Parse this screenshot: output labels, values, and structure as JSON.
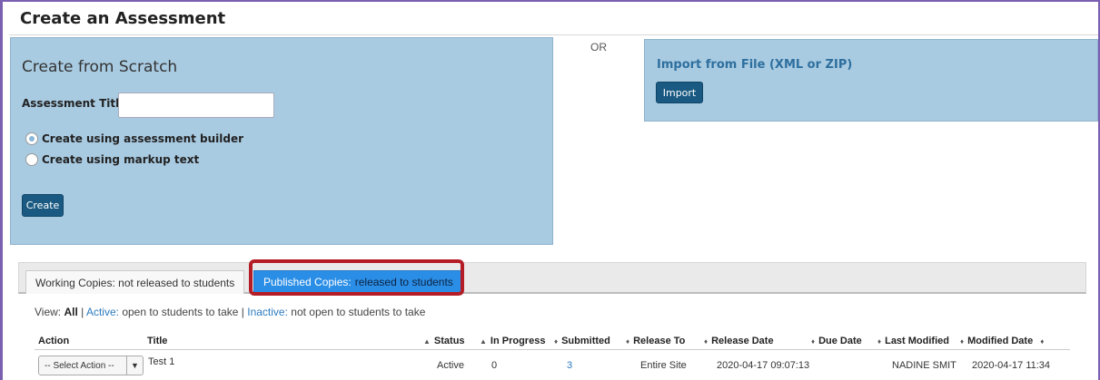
{
  "page": {
    "title": "Create an Assessment"
  },
  "scratch": {
    "heading": "Create from Scratch",
    "title_label": "Assessment Title",
    "title_value": "",
    "options": [
      {
        "label": "Create using assessment builder",
        "checked": true
      },
      {
        "label": "Create using markup text",
        "checked": false
      }
    ],
    "create_button": "Create"
  },
  "separator": "OR",
  "import": {
    "heading": "Import from File (XML or ZIP)",
    "import_button": "Import"
  },
  "tabs": {
    "working": {
      "label": "Working Copies:",
      "suffix": "not released to students"
    },
    "published": {
      "label": "Published Copies:",
      "suffix": "released to students"
    }
  },
  "view": {
    "prefix": "View:",
    "all": "All",
    "sep": "|",
    "active_link": "Active:",
    "active_desc": "open to students to take",
    "inactive_link": "Inactive:",
    "inactive_desc": "not open to students to take"
  },
  "table": {
    "headers": {
      "action": "Action",
      "title": "Title",
      "status": "Status",
      "in_progress": "In Progress",
      "submitted": "Submitted",
      "release_to": "Release To",
      "release_date": "Release Date",
      "due_date": "Due Date",
      "last_modified": "Last Modified",
      "modified_date": "Modified Date"
    },
    "rows": [
      {
        "action": "-- Select Action --",
        "title": "Test 1",
        "status": "Active",
        "in_progress": "0",
        "submitted": "3",
        "release_to": "Entire Site",
        "release_date": "2020-04-17 09:07:13",
        "due_date": "",
        "last_modified": "NADINE SMIT",
        "modified_date": "2020-04-17 11:34"
      }
    ]
  },
  "colors": {
    "panel": "#a9cbe2",
    "button": "#1a5a82",
    "active_tab": "#2b8ee6",
    "highlight": "#b51d26"
  }
}
